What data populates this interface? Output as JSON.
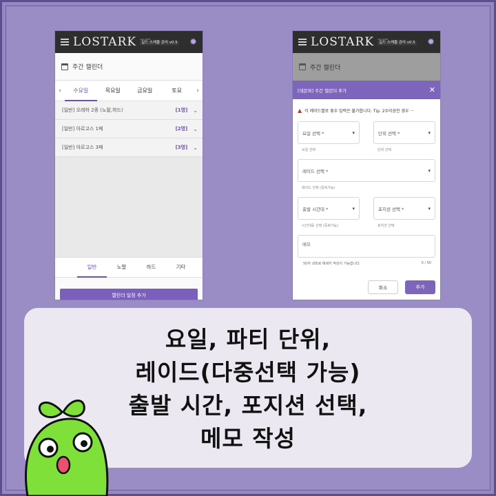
{
  "left_phone": {
    "logo": "LOSTARK",
    "logo_tiny": "LOA SCHE",
    "version_badge": "길드 스케쥴 관리 v0.5",
    "page_title": "주간 캘린더",
    "day_tabs": [
      "수요일",
      "목요일",
      "금요일",
      "토요"
    ],
    "active_day": "수요일",
    "raids": [
      {
        "name": "[일반] 오레하 2종 (노말,하드)",
        "count": "[1명]"
      },
      {
        "name": "[일반] 아르고스 1페",
        "count": "[2명]"
      },
      {
        "name": "[일반] 아르고스 3페",
        "count": "[3명]"
      }
    ],
    "difficulty_tabs": [
      "일반",
      "노말",
      "하드",
      "기타"
    ],
    "active_difficulty": "일반",
    "add_button": "캘린더 일정 추가"
  },
  "right_phone": {
    "logo": "LOSTARK",
    "logo_tiny": "LOA SCHE",
    "version_badge": "길드 스케쥴 관리 v0.5",
    "page_title": "주간 캘린더",
    "modal_title": "[데몬파] 주간 캘린더 추가",
    "warning": "각 레이드별로 횟수 입력은 불가합니다. Tip. 2수이상인 경우 ···",
    "day_select": {
      "label": "요일 선택 *",
      "helper": "요일 선택"
    },
    "unit_select": {
      "label": "단위 선택 *",
      "helper": "단위 선택"
    },
    "raid_select": {
      "label": "레이드 선택 *",
      "helper": "레이드 선택 (중복가능)"
    },
    "time_select": {
      "label": "출발 시간대 *",
      "helper": "시간대를 선택 (중복가능)"
    },
    "position_select": {
      "label": "포지션 선택 *",
      "helper": "포지션 선택"
    },
    "memo_placeholder": "메모",
    "memo_helper": "50자 내외로 메세지 작성이 가능합니다.",
    "memo_counter": "0 / 50",
    "cancel_button": "취소",
    "add_button": "추가"
  },
  "caption": {
    "line1": "요일, 파티 단위,",
    "line2": "레이드(다중선택 가능)",
    "line3": "출발 시간, 포지션 선택,",
    "line4": "메모 작성"
  },
  "colors": {
    "background": "#9a8cc4",
    "accent": "#7d65bb",
    "caption_card": "#ebe8f2",
    "mascot": "#7fe03a"
  }
}
